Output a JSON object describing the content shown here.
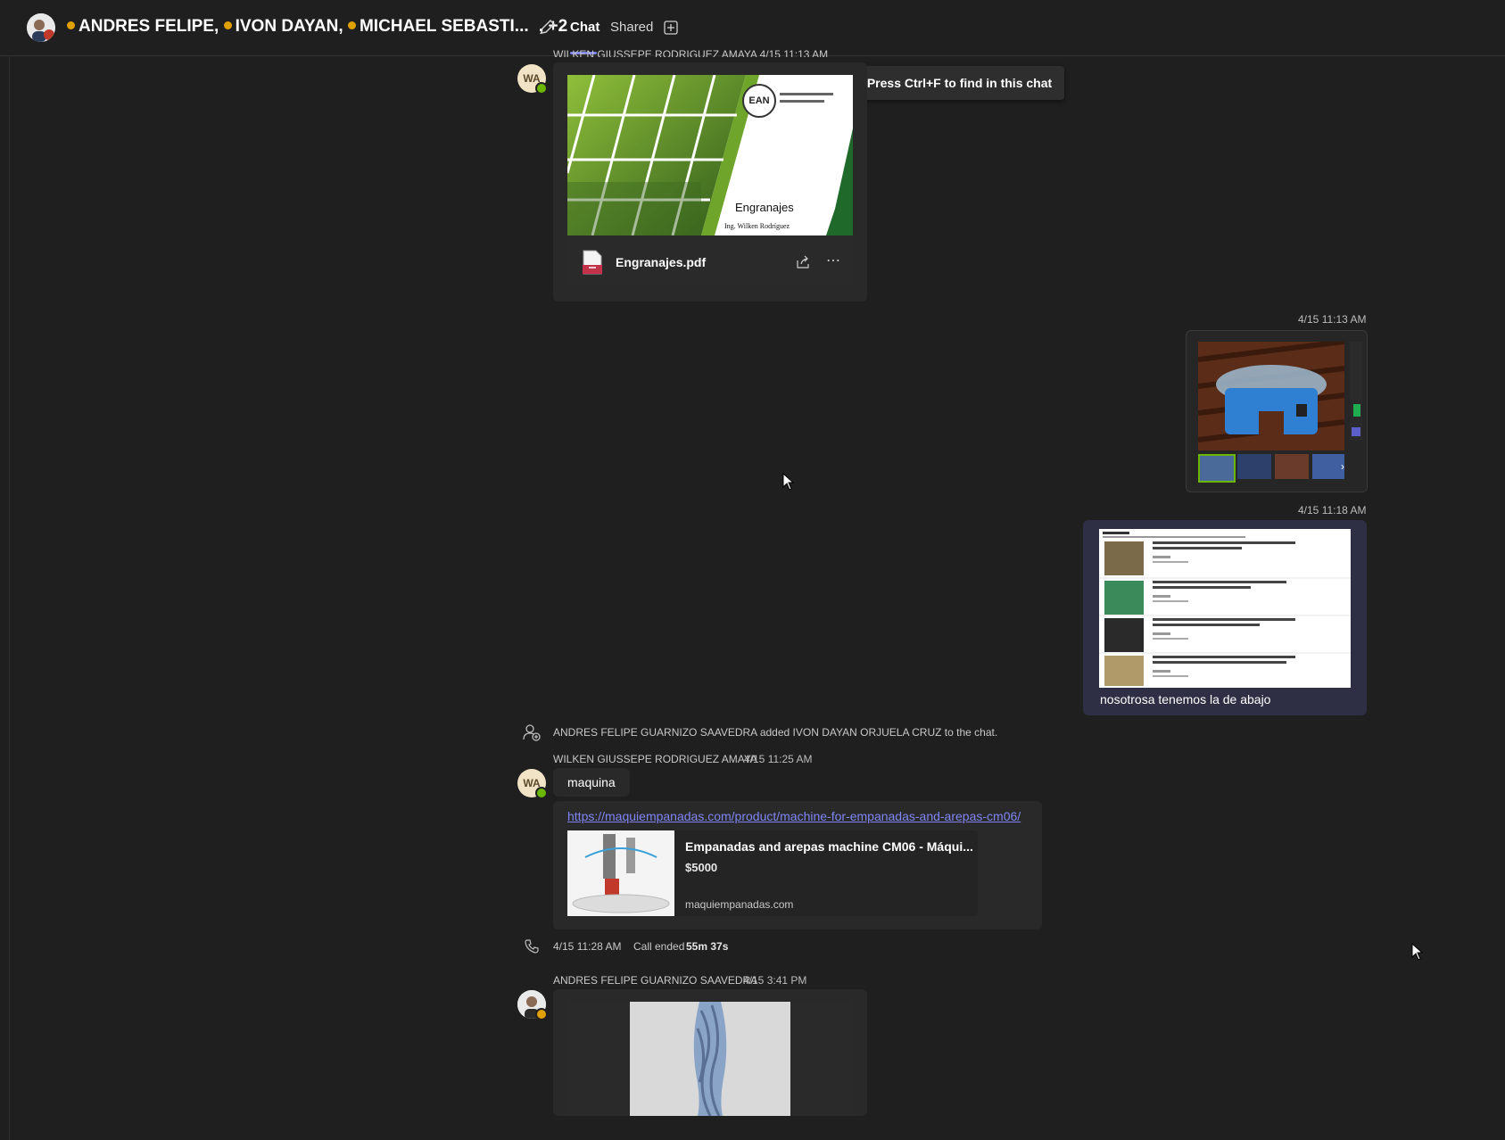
{
  "header": {
    "participants": [
      "ANDRES FELIPE",
      "IVON DAYAN",
      "MICHAEL SEBASTI..."
    ],
    "extra_count": ", +2",
    "tabs": [
      {
        "label": "Chat",
        "active": true
      },
      {
        "label": "Shared",
        "active": false
      }
    ],
    "edit_icon": "pencil-icon",
    "add_tab_icon": "add-tab-icon"
  },
  "tooltip": "Press Ctrl+F to find in this chat",
  "messages": {
    "pdf": {
      "sender_partial": "WILKEN GIUSSEPE RODRIGUEZ AMAYA  4/15 11:13 AM",
      "avatar_initials": "WA",
      "slide_title": "Engranajes",
      "slide_author": "Ing. Wilken Rodríguez",
      "slide_logo": "EAN",
      "file_name": "Engranajes.pdf"
    },
    "image1": {
      "time": "4/15 11:13 AM"
    },
    "image2": {
      "time": "4/15 11:18 AM",
      "text": "nosotrosa tenemos la de abajo"
    },
    "system_added": "ANDRES FELIPE GUARNIZO SAAVEDRA added IVON DAYAN ORJUELA CRUZ to the chat.",
    "wilken2": {
      "sender": "WILKEN GIUSSEPE RODRIGUEZ AMAYA",
      "time": "4/15 11:25 AM",
      "avatar_initials": "WA",
      "text": "maquina",
      "link": "https://maquiempanadas.com/product/machine-for-empanadas-and-arepas-cm06/",
      "preview_title": "Empanadas and arepas machine CM06 - Máqui...",
      "preview_price": "$5000",
      "preview_domain": "maquiempanadas.com"
    },
    "call": {
      "time": "4/15 11:28 AM",
      "label": "Call ended",
      "duration": "55m 37s"
    },
    "andres": {
      "sender": "ANDRES FELIPE GUARNIZO SAAVEDRA",
      "time": "4/15 3:41 PM"
    }
  },
  "colors": {
    "accent": "#7f85f5",
    "available": "#6bb700",
    "away": "#e0a100"
  }
}
